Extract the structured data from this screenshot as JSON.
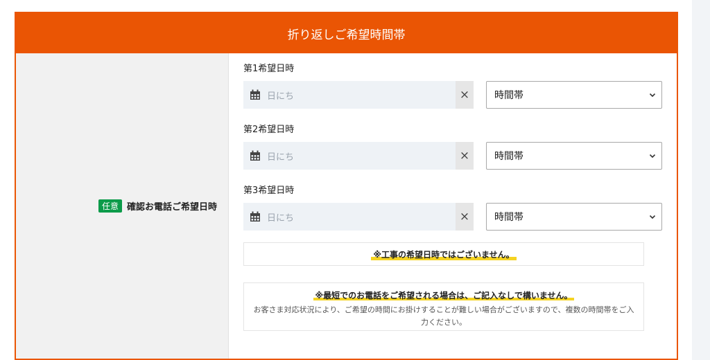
{
  "section": {
    "title": "折り返しご希望時間帯"
  },
  "field": {
    "badge": "任意",
    "label": "確認お電話ご希望日時"
  },
  "slots": [
    {
      "label": "第1希望日時",
      "date_placeholder": "日にち",
      "time_value": "時間帯"
    },
    {
      "label": "第2希望日時",
      "date_placeholder": "日にち",
      "time_value": "時間帯"
    },
    {
      "label": "第3希望日時",
      "date_placeholder": "日にち",
      "time_value": "時間帯"
    }
  ],
  "clear_symbol": "×",
  "notes": {
    "note1": "※工事の希望日時ではございません。",
    "note2_title": "※最短でのお電話をご希望される場合は、ご記入なしで構いません。",
    "note2_body": "お客さま対応状況により、ご希望の時間にお掛けすることが難しい場合がございますので、複数の時間帯をご入力ください。"
  },
  "colors": {
    "accent": "#ea5504",
    "badge": "#0c9b4a",
    "highlight": "#f5d322"
  },
  "icons": {
    "date": "calendar-icon",
    "select": "chevron-down-icon",
    "clear": "close-icon"
  }
}
